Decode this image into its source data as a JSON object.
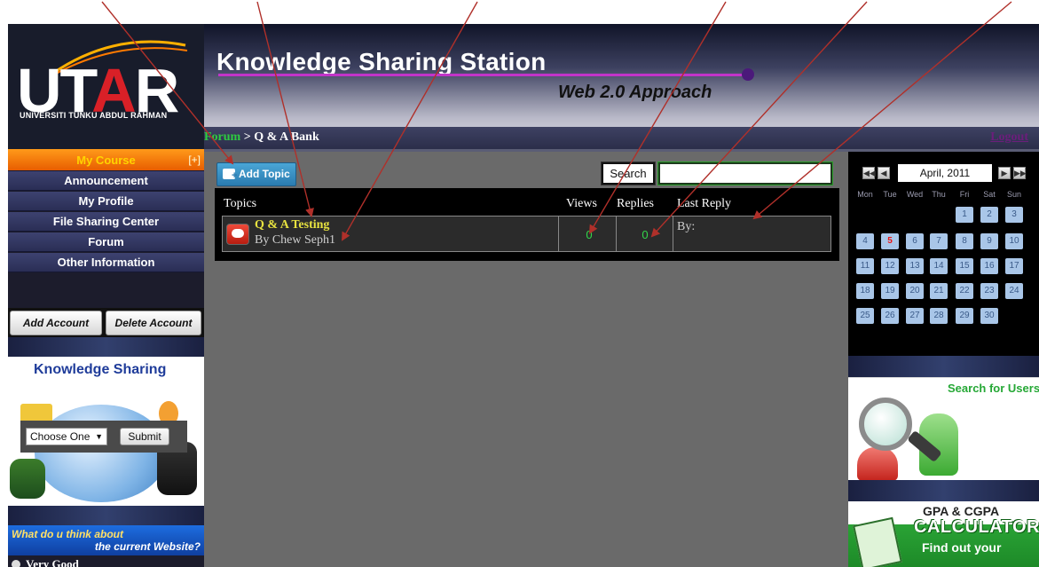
{
  "header": {
    "logo_text_1": "UT",
    "logo_text_a": "A",
    "logo_text_2": "R",
    "logo_sub": "UNIVERSITI TUNKU ABDUL RAHMAN",
    "title": "Knowledge Sharing Station",
    "subtitle": "Web 2.0 Approach"
  },
  "navbar": {
    "crumb_link": "Forum",
    "crumb_rest": " > Q & A Bank",
    "logout": "Logout"
  },
  "sidebar": {
    "my_course": "My Course",
    "my_course_toggle": "[+]",
    "items": [
      {
        "label": "Announcement"
      },
      {
        "label": "My Profile"
      },
      {
        "label": "File Sharing Center"
      },
      {
        "label": "Forum"
      },
      {
        "label": "Other Information"
      }
    ],
    "add_account": "Add Account",
    "delete_account": "Delete Account",
    "knowledge_title": "Knowledge Sharing",
    "select_value": "Choose One",
    "submit": "Submit",
    "poll_line1": "What do u think about",
    "poll_line2": "the current Website?",
    "poll_option": "Very Good"
  },
  "main": {
    "add_topic": "Add Topic",
    "search_button": "Search",
    "search_value": "",
    "columns": {
      "topics": "Topics",
      "views": "Views",
      "replies": "Replies",
      "last_reply": "Last Reply"
    },
    "rows": [
      {
        "title": "Q & A Testing",
        "author": "By Chew Seph1",
        "views": "0",
        "replies": "0",
        "last_reply": "By:"
      }
    ]
  },
  "calendar": {
    "title": "April, 2011",
    "prev2": "◀◀",
    "prev": "◀",
    "next": "▶",
    "next2": "▶▶",
    "dow": [
      "Mon",
      "Tue",
      "Wed",
      "Thu",
      "Fri",
      "Sat",
      "Sun"
    ],
    "today": "5",
    "weeks": [
      [
        "",
        "",
        "",
        "",
        "1",
        "2",
        "3"
      ],
      [
        "4",
        "5",
        "6",
        "7",
        "8",
        "9",
        "10"
      ],
      [
        "11",
        "12",
        "13",
        "14",
        "15",
        "16",
        "17"
      ],
      [
        "18",
        "19",
        "20",
        "21",
        "22",
        "23",
        "24"
      ],
      [
        "25",
        "26",
        "27",
        "28",
        "29",
        "30",
        ""
      ]
    ]
  },
  "right_widgets": {
    "search_users": "Search for Users",
    "gpa_line1": "GPA & CGPA",
    "gpa_line2": "CALCULATOR",
    "gpa_line3": "Find out your"
  },
  "colors": {
    "accent_orange": "#ff8a10",
    "nav_blue": "#2f3461",
    "topic_yellow": "#e8e340",
    "count_green": "#33d64a",
    "arrow_red": "#b0302a"
  }
}
